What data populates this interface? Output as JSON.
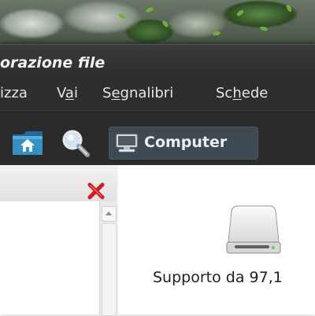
{
  "window": {
    "title": "orazione file"
  },
  "menu": [
    {
      "before": "izza",
      "mnemonic": "",
      "after": ""
    },
    {
      "before": "V",
      "mnemonic": "a",
      "after": "i"
    },
    {
      "before": "S",
      "mnemonic": "e",
      "after": "gnalibri"
    },
    {
      "before": "Sc",
      "mnemonic": "h",
      "after": "ede"
    }
  ],
  "toolbar": {
    "home_icon": "home-folder-icon",
    "search_icon": "magnifier-icon",
    "location_button": {
      "label": "Computer",
      "icon": "computer-icon"
    }
  },
  "sidepane": {
    "close_icon": "red-x-icon"
  },
  "main": {
    "items": [
      {
        "label": "Supporto da 97,1",
        "icon": "removable-drive-icon"
      }
    ]
  },
  "colors": {
    "accent": "#3d4a53",
    "close": "#d01c1c",
    "folder": "#2b7fb2"
  }
}
